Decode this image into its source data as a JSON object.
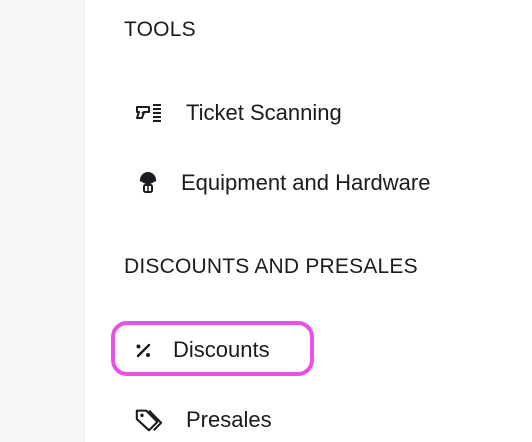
{
  "sections": {
    "tools": {
      "heading": "TOOLS",
      "items": [
        {
          "label": "Ticket Scanning",
          "icon": "scanner-icon"
        },
        {
          "label": "Equipment and Hardware",
          "icon": "hardware-icon"
        }
      ]
    },
    "discounts": {
      "heading": "DISCOUNTS AND PRESALES",
      "items": [
        {
          "label": "Discounts",
          "icon": "percent-icon",
          "highlighted": true,
          "highlight_color": "#ec4fe6"
        },
        {
          "label": "Presales",
          "icon": "tags-icon"
        }
      ]
    }
  }
}
